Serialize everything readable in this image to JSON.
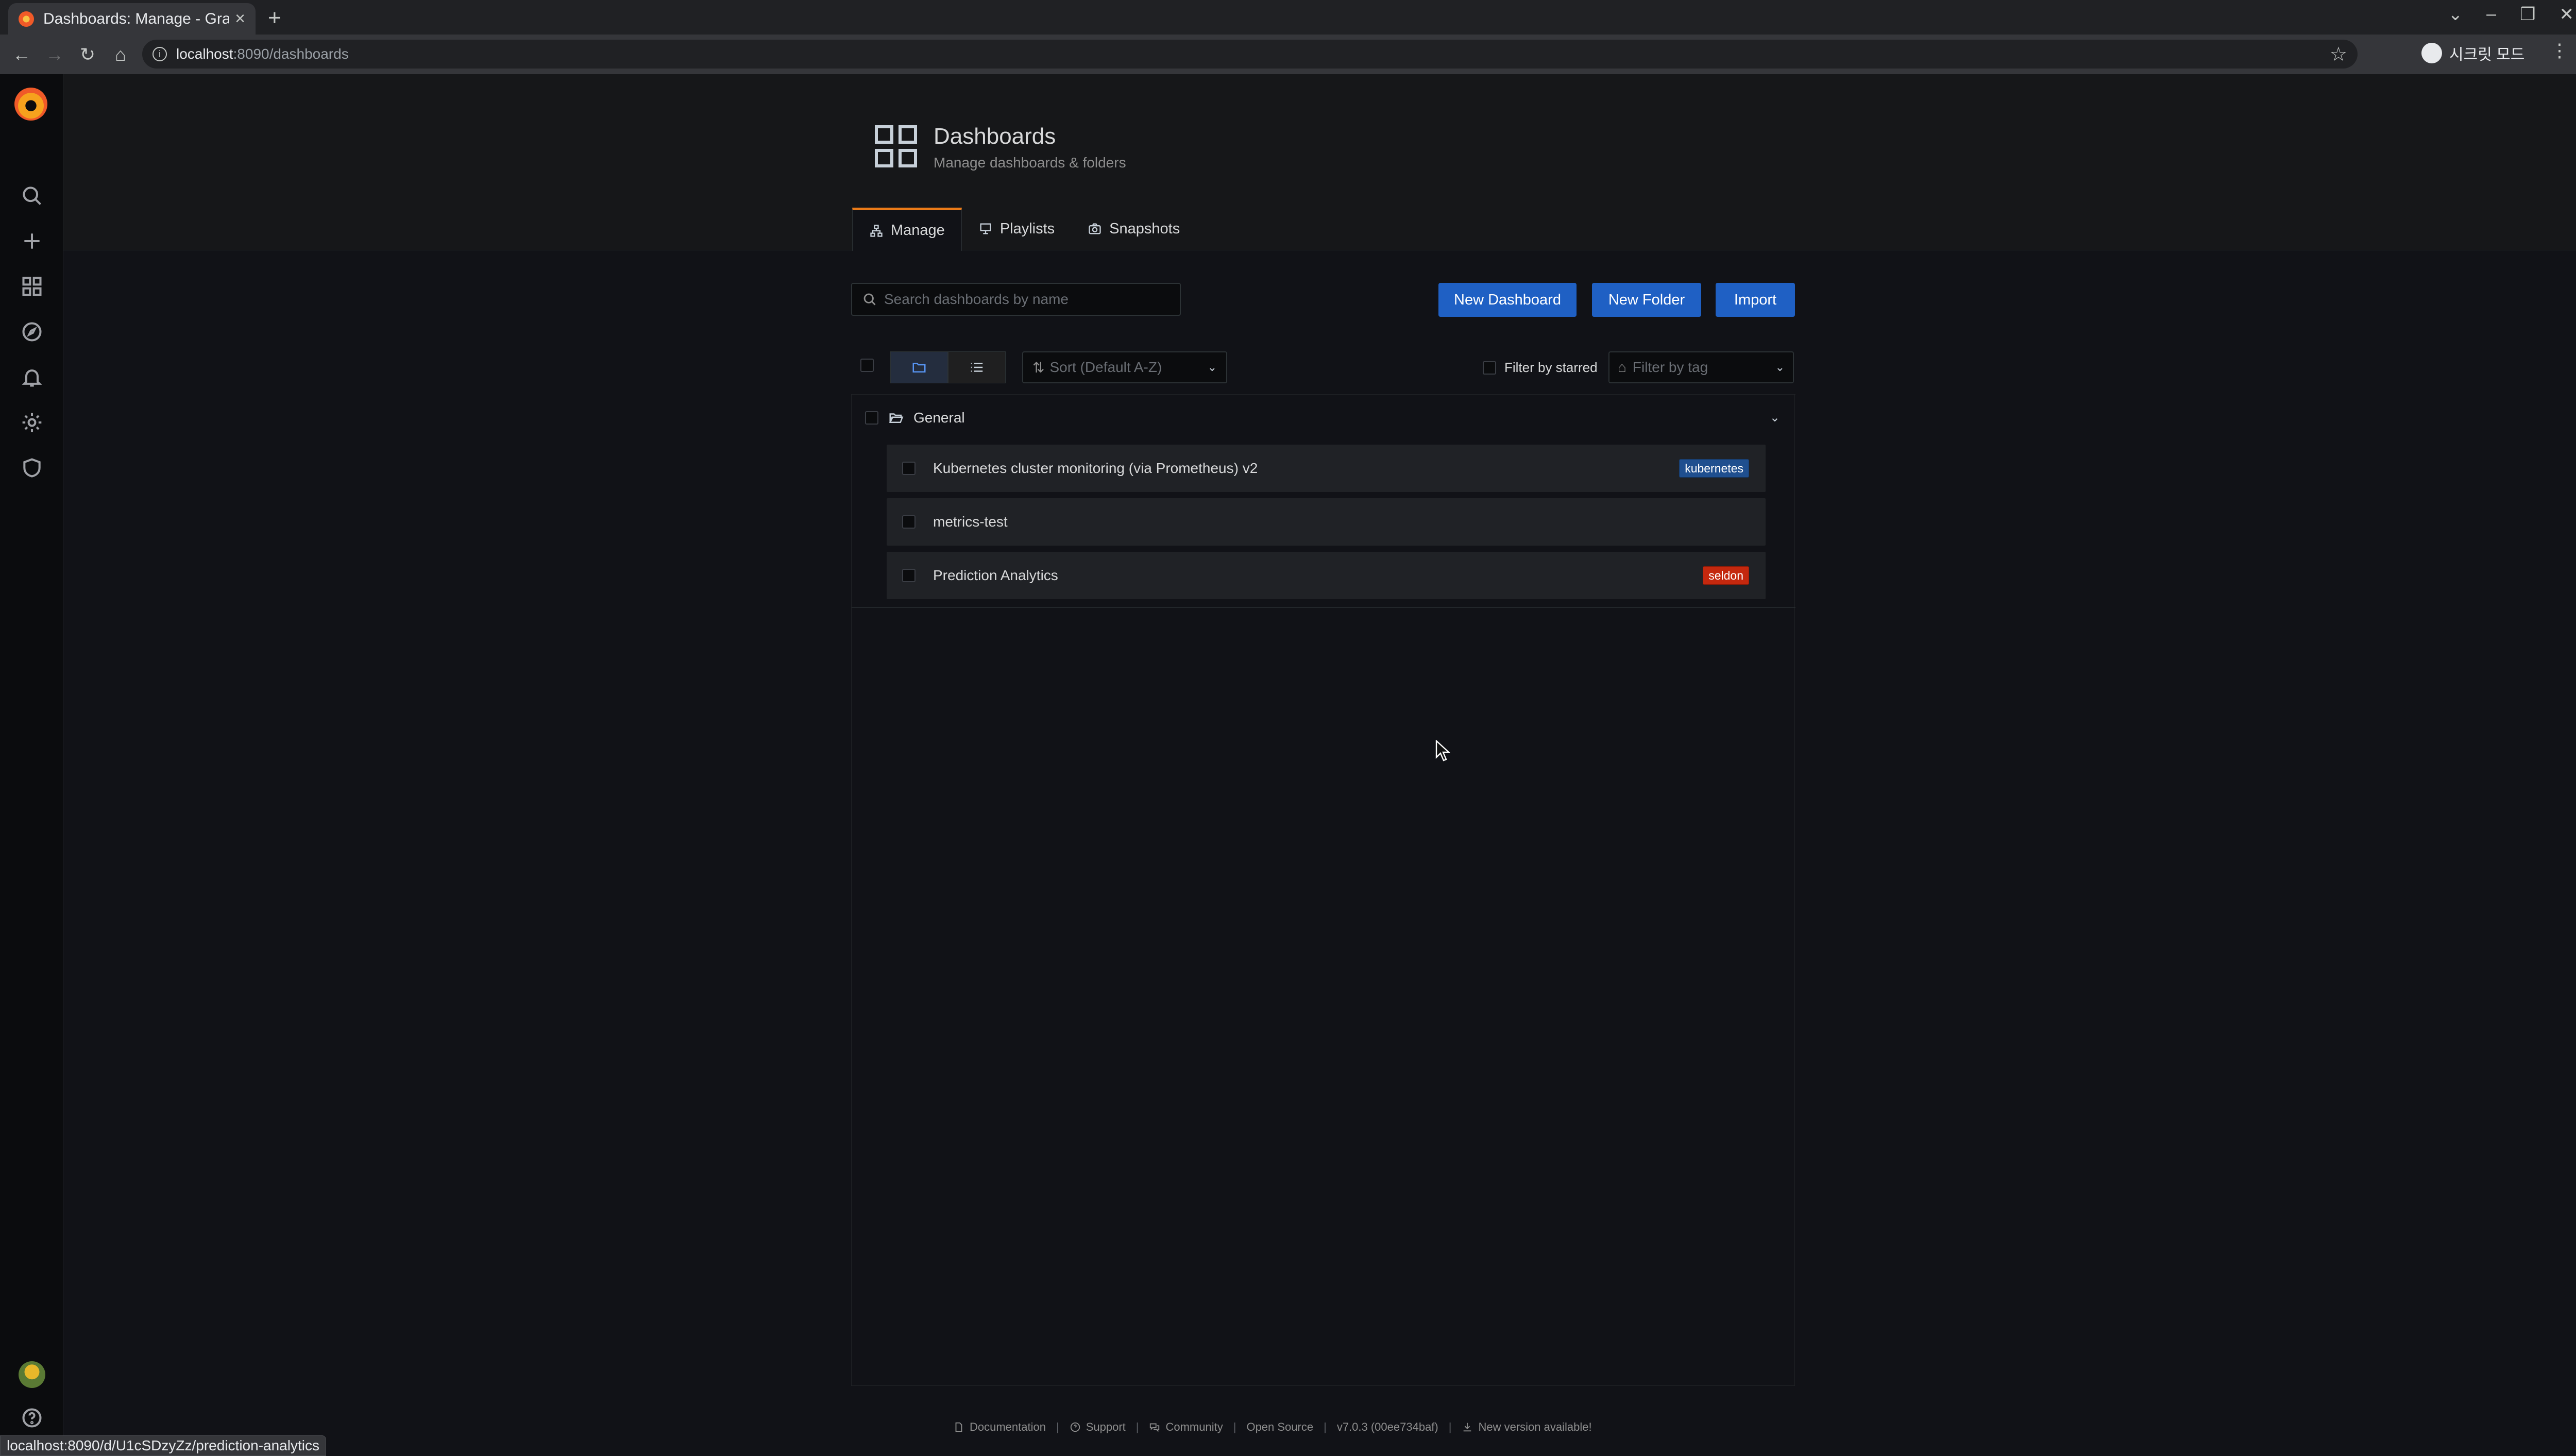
{
  "browser": {
    "tab_title": "Dashboards: Manage - Gra",
    "url_host": "localhost",
    "url_rest": ":8090/dashboards",
    "profile_label": "시크릿 모드",
    "status_url": "localhost:8090/d/U1cSDzyZz/prediction-analytics"
  },
  "header": {
    "title": "Dashboards",
    "subtitle": "Manage dashboards & folders",
    "tabs": [
      {
        "label": "Manage",
        "icon": "sitemap-icon",
        "active": true
      },
      {
        "label": "Playlists",
        "icon": "presentation-icon",
        "active": false
      },
      {
        "label": "Snapshots",
        "icon": "camera-icon",
        "active": false
      }
    ]
  },
  "toolbar": {
    "search_placeholder": "Search dashboards by name",
    "new_dashboard": "New Dashboard",
    "new_folder": "New Folder",
    "import": "Import",
    "sort_placeholder": "Sort (Default A-Z)",
    "filter_starred": "Filter by starred",
    "filter_tag_placeholder": "Filter by tag"
  },
  "results": {
    "folder": "General",
    "items": [
      {
        "title": "Kubernetes cluster monitoring (via Prometheus) v2",
        "tag": "kubernetes",
        "tag_color": "#1f4f8f"
      },
      {
        "title": "metrics-test",
        "tag": "",
        "tag_color": ""
      },
      {
        "title": "Prediction Analytics",
        "tag": "seldon",
        "tag_color": "#c4280e"
      }
    ]
  },
  "footer": {
    "documentation": "Documentation",
    "support": "Support",
    "community": "Community",
    "open_source": "Open Source",
    "version": "v7.0.3 (00ee734baf)",
    "new_version": "New version available!"
  },
  "colors": {
    "accent_primary": "#1f60c4",
    "active_tab_border": "#eb7b18",
    "background": "#111217"
  }
}
